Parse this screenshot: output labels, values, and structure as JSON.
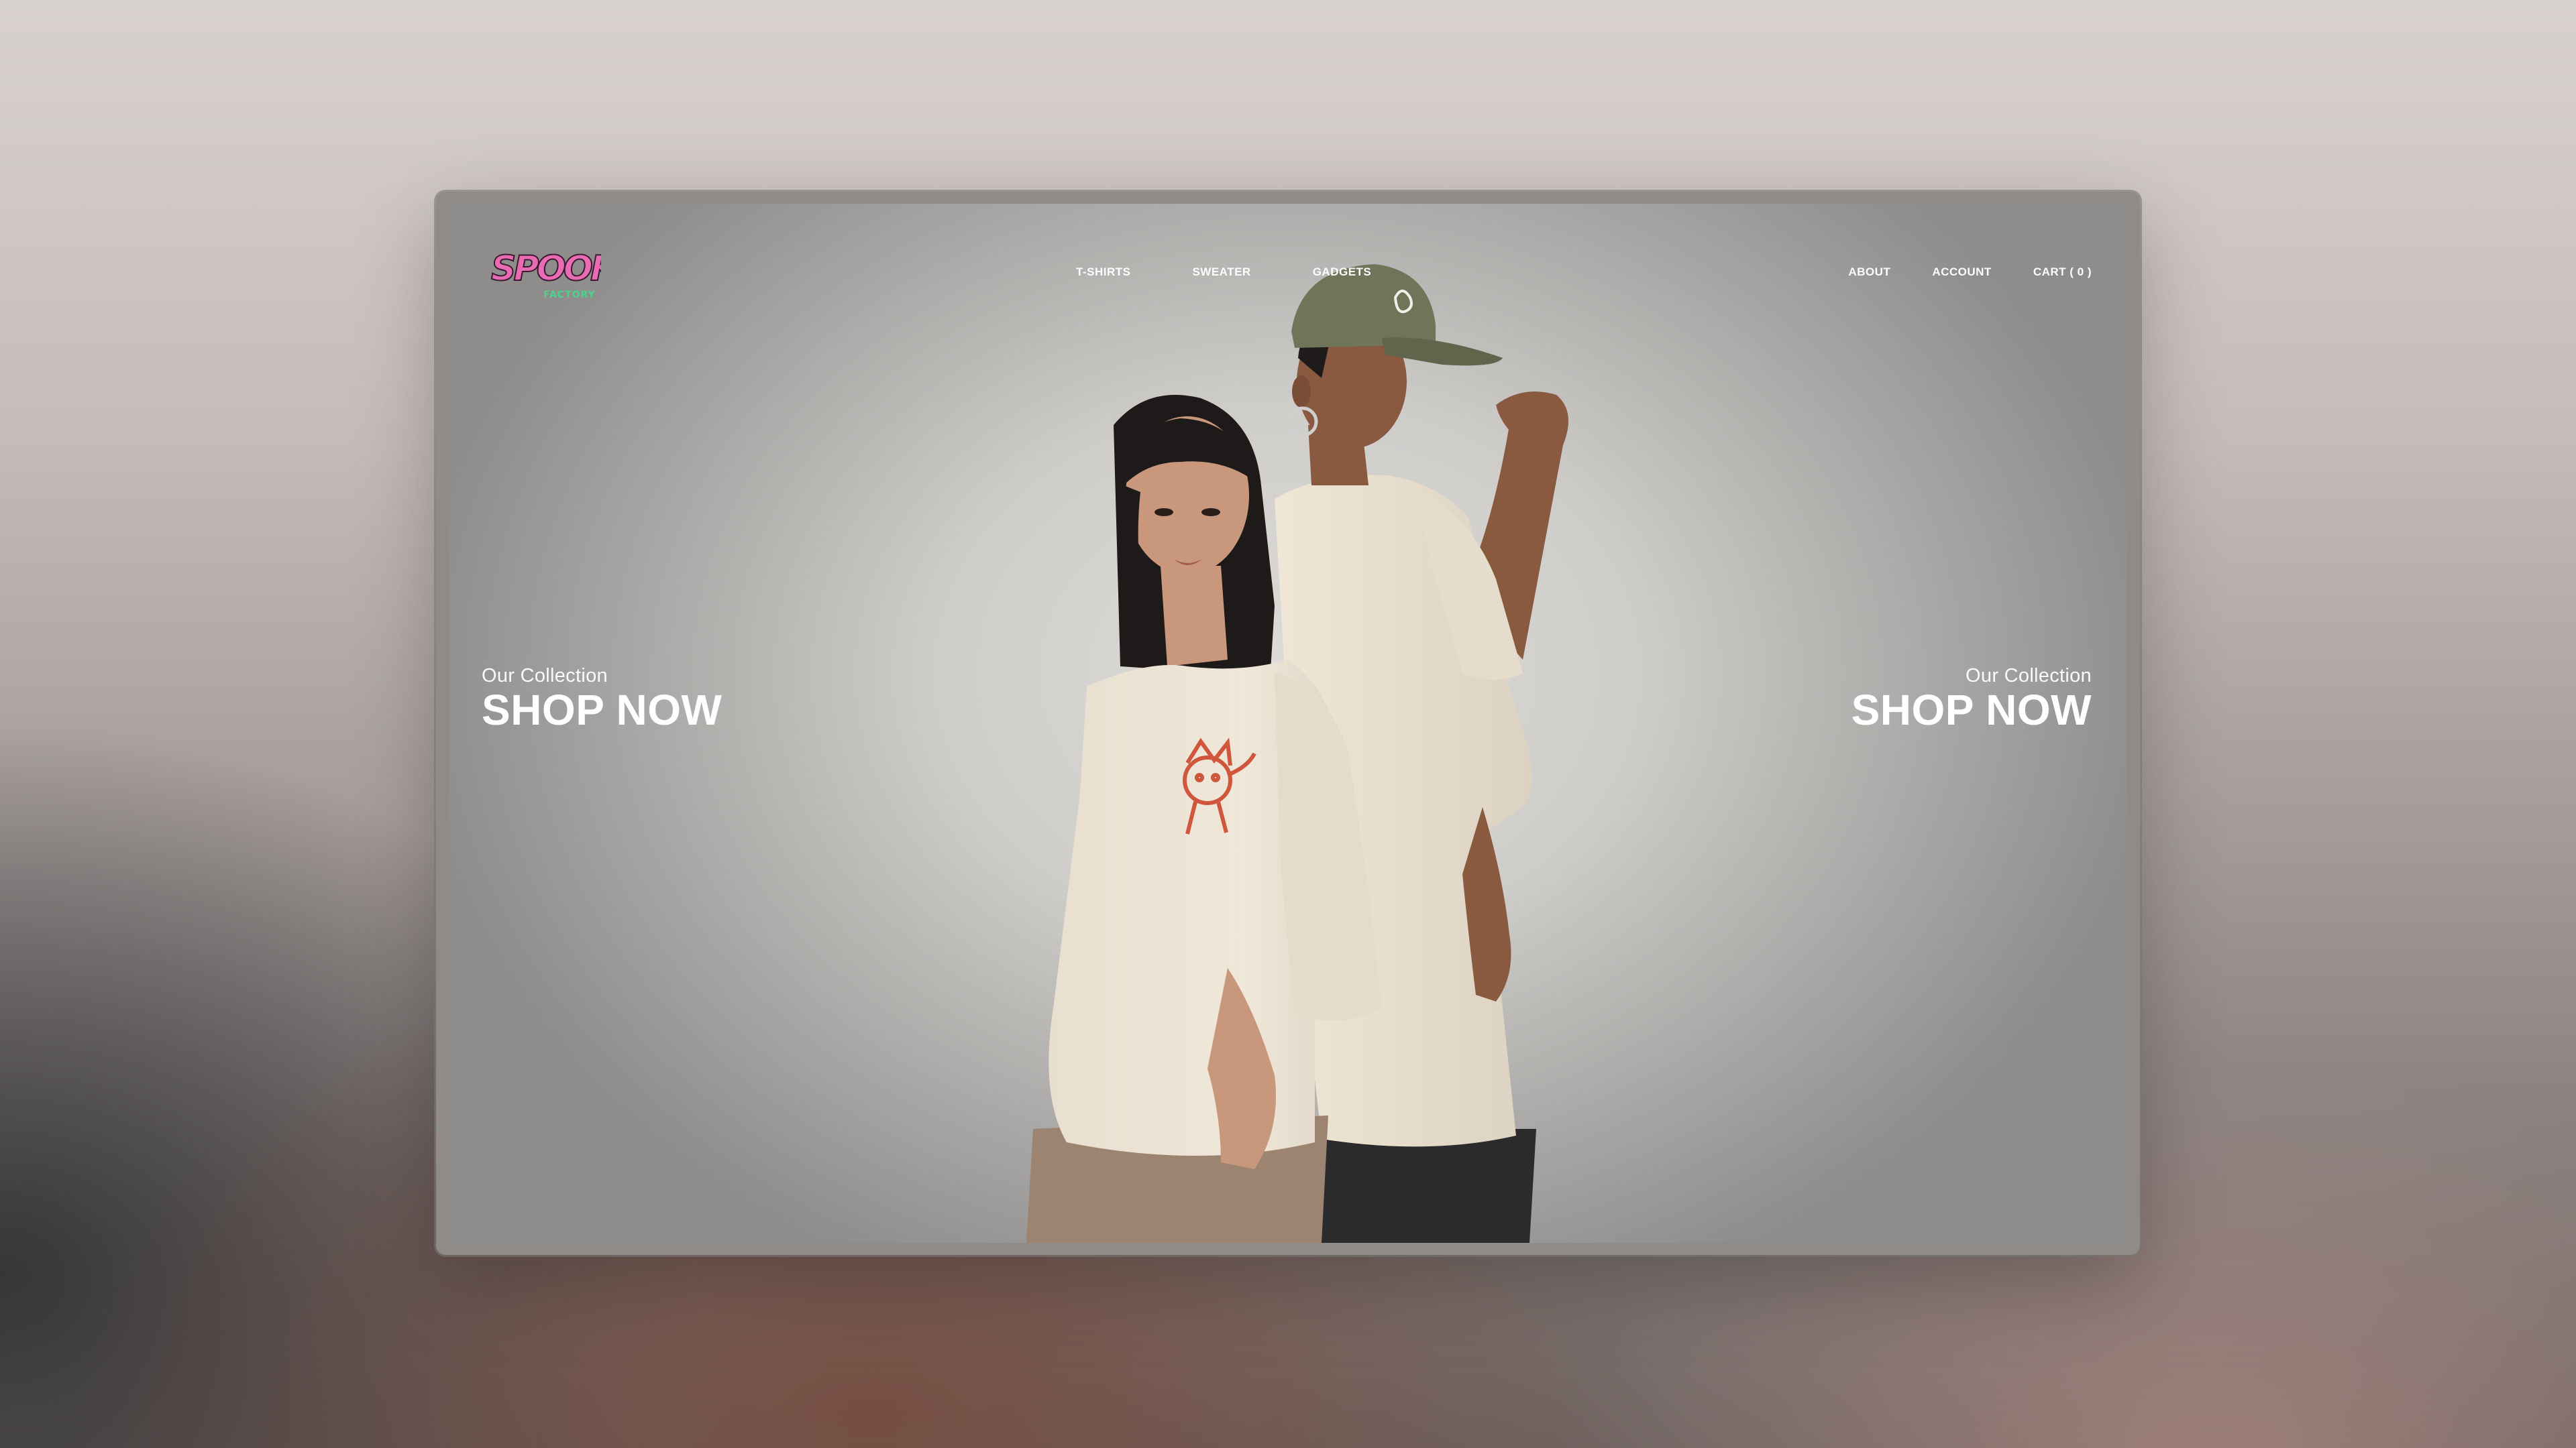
{
  "brand": {
    "logo_text": "SPOOKY",
    "logo_subtext": "FACTORY",
    "logo_pink": "#e86bb3",
    "logo_green": "#49d38a"
  },
  "nav": {
    "center": [
      "T-SHIRTS",
      "SWEATER",
      "GADGETS"
    ],
    "right": [
      "ABOUT",
      "ACCOUNT",
      "CART ( 0 )"
    ]
  },
  "hero": {
    "left": {
      "subtitle": "Our Collection",
      "cta": "SHOP NOW"
    },
    "right": {
      "subtitle": "Our Collection",
      "cta": "SHOP NOW"
    }
  },
  "colors": {
    "shirt": "#ece3d3",
    "cap": "#6e7559",
    "graphic": "#d0563c",
    "hair": "#1e1a1a",
    "skin_light": "#c9977c",
    "skin_dark": "#8a5a40",
    "pants_tan": "#9c8470",
    "pants_dark": "#2b2a2c"
  }
}
